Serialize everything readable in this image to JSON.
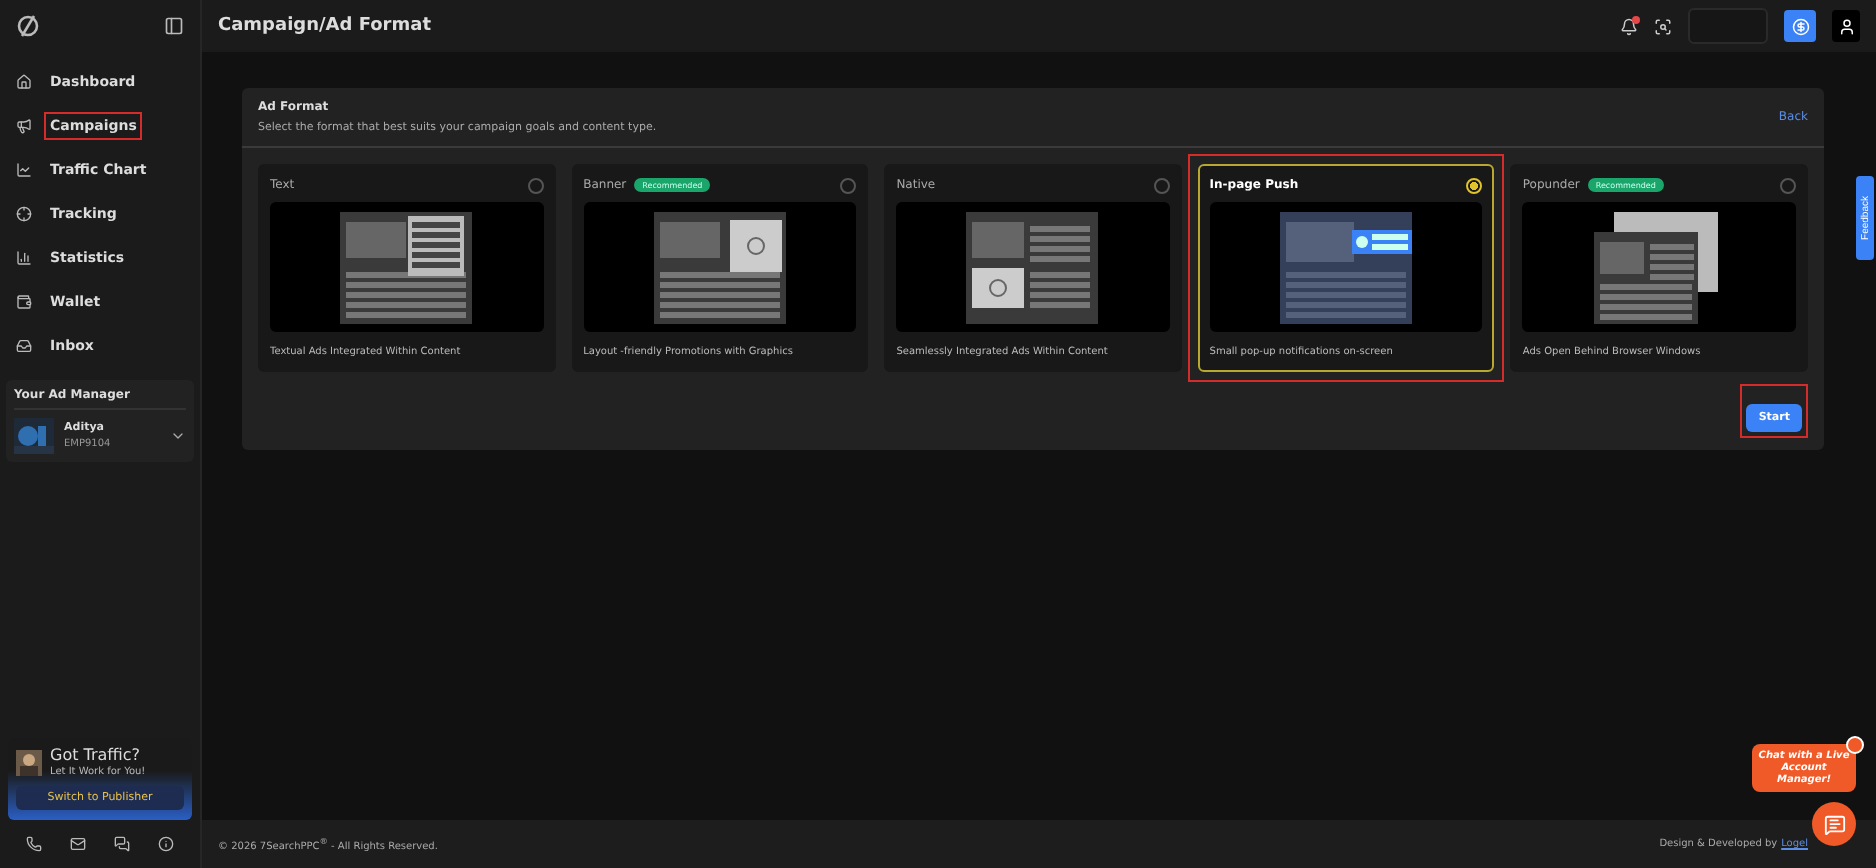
{
  "header": {
    "title": "Campaign/Ad Format",
    "notification_dot": true
  },
  "sidebar": {
    "items": [
      {
        "label": "Dashboard",
        "kind": "home",
        "highlighted": false
      },
      {
        "label": "Campaigns",
        "kind": "campaigns",
        "highlighted": true
      },
      {
        "label": "Traffic Chart",
        "kind": "chart",
        "highlighted": false
      },
      {
        "label": "Tracking",
        "kind": "tracking",
        "highlighted": false
      },
      {
        "label": "Statistics",
        "kind": "stats",
        "highlighted": false
      },
      {
        "label": "Wallet",
        "kind": "wallet",
        "highlighted": false
      },
      {
        "label": "Inbox",
        "kind": "inbox",
        "highlighted": false
      }
    ],
    "manager": {
      "heading": "Your Ad Manager",
      "name": "Aditya",
      "code": "EMP9104"
    },
    "promo": {
      "title": "Got Traffic?",
      "subtitle": "Let It Work for You!",
      "button": "Switch to Publisher"
    }
  },
  "panel": {
    "title": "Ad Format",
    "subtitle": "Select the format that best suits your campaign goals and content type.",
    "back": "Back",
    "cards": [
      {
        "title": "Text",
        "kind": "text",
        "caption": "Textual Ads Integrated Within Content",
        "selected": false,
        "highlighted": false
      },
      {
        "title": "Banner",
        "kind": "banner",
        "badge": "Recommended",
        "caption": "Layout -friendly Promotions with Graphics",
        "selected": false,
        "highlighted": false
      },
      {
        "title": "Native",
        "kind": "native",
        "caption": "Seamlessly Integrated Ads Within Content",
        "selected": false,
        "highlighted": false
      },
      {
        "title": "In-page Push",
        "kind": "push",
        "caption": "Small pop-up notifications on-screen",
        "selected": true,
        "highlighted": true
      },
      {
        "title": "Popunder",
        "kind": "popunder",
        "badge": "Recommended",
        "caption": "Ads Open Behind Browser Windows",
        "selected": false,
        "highlighted": false
      }
    ],
    "start": {
      "label": "Start",
      "highlighted": true
    }
  },
  "feedback": "Feedback",
  "footer": {
    "copyright": "© 2026 7SearchPPC",
    "mark": "®",
    "rights": " - All Rights Reserved.",
    "credit": "Design & Developed by",
    "link": "Logel"
  },
  "chat": {
    "message": "Chat with a Live Account Manager!"
  }
}
